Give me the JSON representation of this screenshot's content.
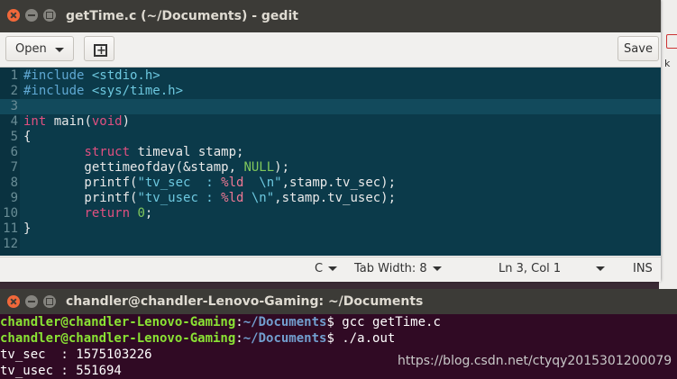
{
  "gedit": {
    "title": "getTime.c (~/Documents) - gedit",
    "open_label": "Open",
    "save_label": "Save"
  },
  "code_lines": [
    {
      "n": "1",
      "parts": [
        [
          "pp",
          "#include "
        ],
        [
          "str",
          "<stdio.h>"
        ]
      ]
    },
    {
      "n": "2",
      "parts": [
        [
          "pp",
          "#include "
        ],
        [
          "str",
          "<sys/time.h>"
        ]
      ]
    },
    {
      "n": "3",
      "parts": []
    },
    {
      "n": "4",
      "parts": [
        [
          "kw",
          "int"
        ],
        [
          "t",
          " main("
        ],
        [
          "kw",
          "void"
        ],
        [
          "t",
          ")"
        ]
      ]
    },
    {
      "n": "5",
      "parts": [
        [
          "t",
          "{"
        ]
      ]
    },
    {
      "n": "6",
      "parts": [
        [
          "t",
          "        "
        ],
        [
          "kw",
          "struct"
        ],
        [
          "t",
          " timeval stamp;"
        ]
      ]
    },
    {
      "n": "7",
      "parts": [
        [
          "t",
          "        gettimeofday(&stamp, "
        ],
        [
          "num",
          "NULL"
        ],
        [
          "t",
          ");"
        ]
      ]
    },
    {
      "n": "8",
      "parts": [
        [
          "t",
          "        printf("
        ],
        [
          "str",
          "\"tv_sec  : "
        ],
        [
          "fmt",
          "%ld"
        ],
        [
          "str",
          "  \\n\""
        ],
        [
          "t",
          ",stamp.tv_sec);"
        ]
      ]
    },
    {
      "n": "9",
      "parts": [
        [
          "t",
          "        printf("
        ],
        [
          "str",
          "\"tv_usec : "
        ],
        [
          "fmt",
          "%ld"
        ],
        [
          "str",
          " \\n\""
        ],
        [
          "t",
          ",stamp.tv_usec);"
        ]
      ]
    },
    {
      "n": "10",
      "parts": [
        [
          "t",
          "        "
        ],
        [
          "kw",
          "return"
        ],
        [
          "t",
          " "
        ],
        [
          "num",
          "0"
        ],
        [
          "t",
          ";"
        ]
      ]
    },
    {
      "n": "11",
      "parts": [
        [
          "t",
          "}"
        ]
      ]
    },
    {
      "n": "12",
      "parts": []
    }
  ],
  "current_line": 2,
  "statusbar": {
    "language": "C",
    "tab_width": "Tab Width: 8",
    "position": "Ln 3, Col 1",
    "mode": "INS"
  },
  "terminal": {
    "title": "chandler@chandler-Lenovo-Gaming: ~/Documents",
    "lines": [
      {
        "user": "chandler@chandler-Lenovo-Gaming",
        "sep": ":",
        "path": "~/Documents",
        "cmd": "$ gcc getTime.c"
      },
      {
        "user": "chandler@chandler-Lenovo-Gaming",
        "sep": ":",
        "path": "~/Documents",
        "cmd": "$ ./a.out"
      },
      {
        "text": "tv_sec  : 1575103226"
      },
      {
        "text": "tv_usec : 551694"
      }
    ]
  },
  "watermark": "https://blog.csdn.net/ctyqy2015301200079",
  "background_fragment": "k"
}
